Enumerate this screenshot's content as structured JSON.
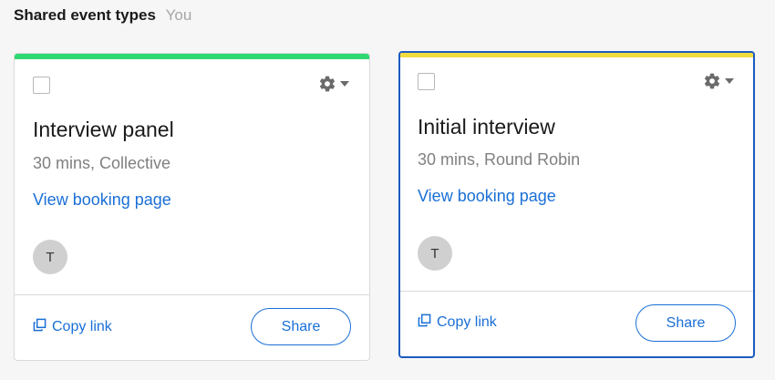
{
  "section": {
    "title": "Shared event types",
    "owner": "You"
  },
  "cards": [
    {
      "name": "Interview panel",
      "meta": "30 mins, Collective",
      "booking_link": "View booking page",
      "avatar_initial": "T",
      "copy_link_label": "Copy link",
      "share_label": "Share",
      "accent_color": "#2ed872",
      "selected": false
    },
    {
      "name": "Initial interview",
      "meta": "30 mins, Round Robin",
      "booking_link": "View booking page",
      "avatar_initial": "T",
      "copy_link_label": "Copy link",
      "share_label": "Share",
      "accent_color": "#f2dc3d",
      "selected": true
    }
  ],
  "icons": {
    "settings": "gear-icon",
    "dropdown": "caret-down-icon",
    "copy": "copy-icon"
  },
  "colors": {
    "link": "#1a6fd6",
    "selected_border": "#1d5bc0"
  }
}
